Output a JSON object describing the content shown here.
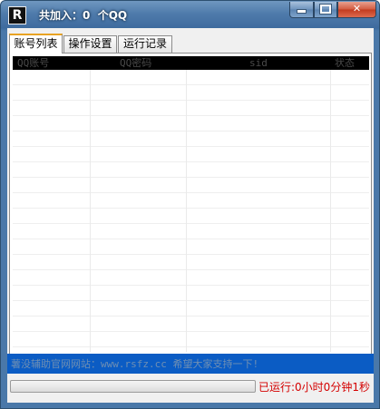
{
  "window": {
    "title": "共加入：0  个QQ",
    "icon_glyph": "R",
    "controls": {
      "minimize": "minimize-icon",
      "maximize": "maximize-icon",
      "close_label": "✕"
    }
  },
  "tabs": [
    {
      "label": "账号列表",
      "active": true
    },
    {
      "label": "操作设置",
      "active": false
    },
    {
      "label": "运行记录",
      "active": false
    }
  ],
  "table": {
    "columns": [
      "QQ账号",
      "QQ密码",
      "sid",
      "状态"
    ],
    "rows": []
  },
  "notice": "薯没辅助官网网站：www.rsfz.cc 希望大家支持一下!",
  "status": {
    "progress": 0,
    "runtime": "已运行:0小时0分钟1秒"
  },
  "colors": {
    "notice_bg": "#0b5cc4",
    "runtime_text": "#d40000",
    "active_tab_accent": "#e8a323",
    "header_bg": "#000000"
  }
}
